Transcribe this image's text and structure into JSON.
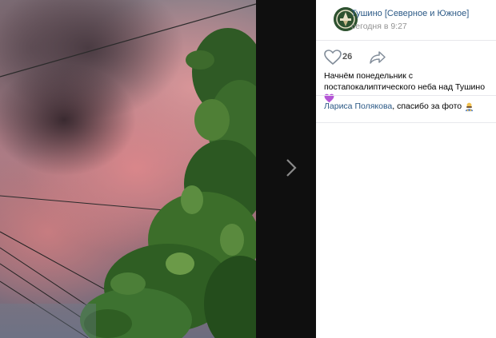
{
  "post": {
    "group_name": "Тушино [Северное и Южное]",
    "timestamp": "сегодня в 9:27",
    "likes": "26",
    "caption": "Начнём понедельник с постапокалиптического неба над Тушино",
    "credit_name": "Лариса Полякова",
    "credit_text": ", спасибо за фото"
  },
  "icons": {
    "avatar": "group-logo",
    "like": "heart-icon",
    "share": "share-arrow-icon",
    "next": "chevron-right-icon",
    "caption_emoji": "purple-heart-emoji",
    "credit_emoji": "person-bowing-emoji"
  },
  "colors": {
    "link": "#2a5885",
    "meta": "#939393",
    "viewer_bg": "#0f0f0f",
    "panel_bg": "#ffffff"
  }
}
